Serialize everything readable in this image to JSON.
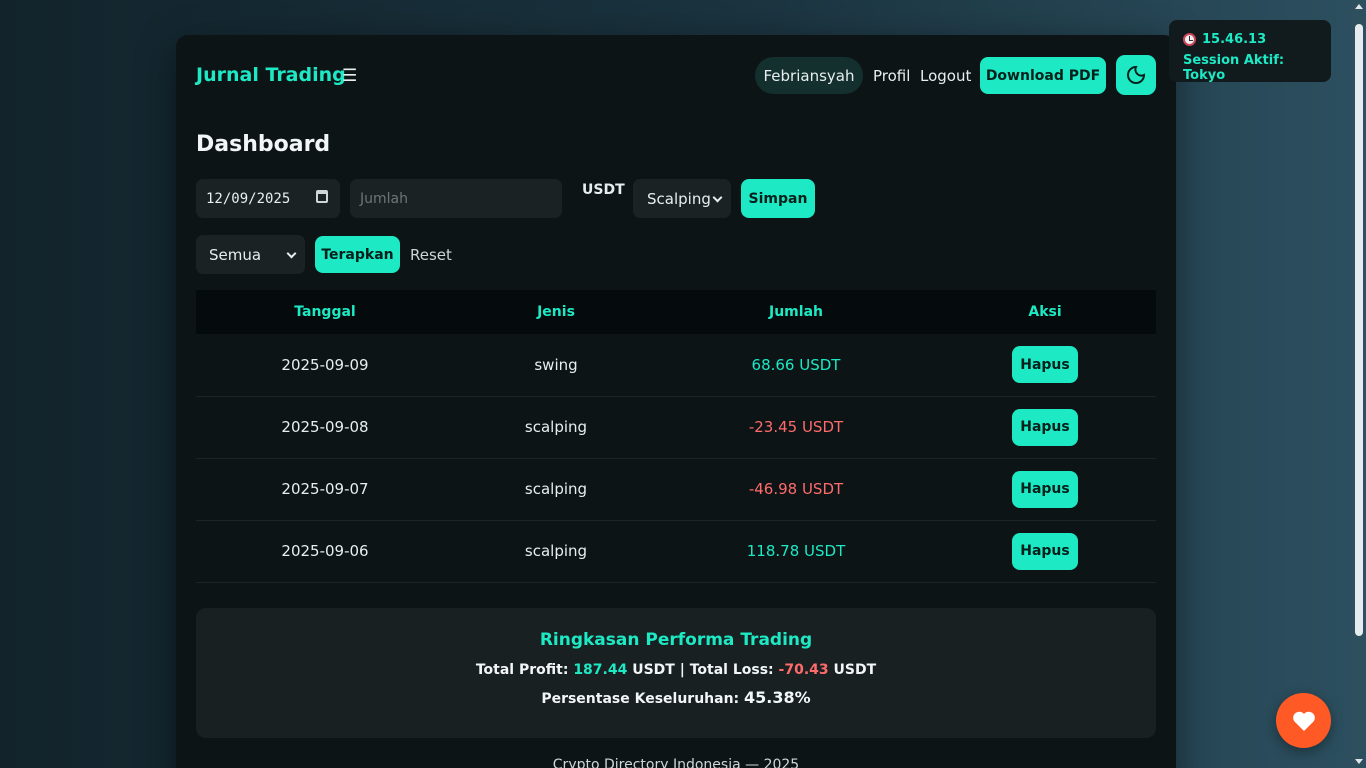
{
  "header": {
    "brand": "Jurnal Trading",
    "username": "Febriansyah",
    "profile_label": "Profil",
    "logout_label": "Logout",
    "download_label": "Download PDF"
  },
  "page_title": "Dashboard",
  "form": {
    "date_value": "12/09/2025",
    "amount_placeholder": "Jumlah",
    "currency": "USDT",
    "type_selected": "Scalping",
    "save_label": "Simpan"
  },
  "filter": {
    "selected": "Semua",
    "apply_label": "Terapkan",
    "reset_label": "Reset"
  },
  "table": {
    "headers": [
      "Tanggal",
      "Jenis",
      "Jumlah",
      "Aksi"
    ],
    "rows": [
      {
        "date": "2025-09-09",
        "type": "swing",
        "amount": "68.66 USDT",
        "action": "Hapus"
      },
      {
        "date": "2025-09-08",
        "type": "scalping",
        "amount": "-23.45 USDT",
        "action": "Hapus"
      },
      {
        "date": "2025-09-07",
        "type": "scalping",
        "amount": "-46.98 USDT",
        "action": "Hapus"
      },
      {
        "date": "2025-09-06",
        "type": "scalping",
        "amount": "118.78 USDT",
        "action": "Hapus"
      }
    ]
  },
  "summary": {
    "title": "Ringkasan Performa Trading",
    "profit_label": "Total Profit:",
    "profit_value": "187.44",
    "currency": "USDT",
    "separator": "|",
    "loss_label": "Total Loss:",
    "loss_value": "-70.43",
    "pct_label": "Persentase Keseluruhan:",
    "pct_value": "45.38%"
  },
  "footer": "Crypto Directory Indonesia — 2025",
  "session": {
    "time": "15.46.13",
    "label": "Session Aktif: Tokyo"
  },
  "colors": {
    "accent": "#1de9c4",
    "negative": "#ff6b6b",
    "fab": "#ff5a26"
  },
  "icons": {
    "menu": "hamburger-icon",
    "theme": "moon-icon",
    "clock": "clock-icon",
    "fab": "heart-icon"
  }
}
